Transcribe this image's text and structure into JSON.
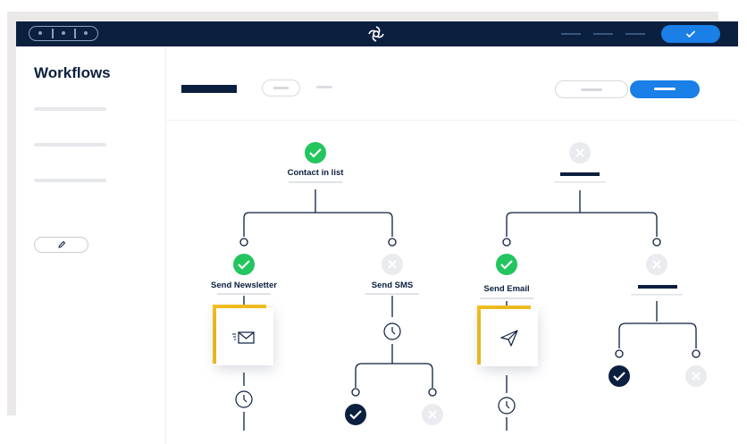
{
  "sidebar": {
    "title": "Workflows"
  },
  "nodes": {
    "contact_in_list": {
      "label": "Contact in list",
      "status": "done"
    },
    "send_newsletter": {
      "label": "Send Newsletter",
      "status": "done"
    },
    "send_sms": {
      "label": "Send SMS",
      "status": "skipped"
    },
    "send_email": {
      "label": "Send Email",
      "status": "done"
    }
  },
  "colors": {
    "navy": "#0b1f3f",
    "success": "#22c55e",
    "primary": "#1a7fe6",
    "accent": "#f7c11e",
    "muted": "#e6e8eb"
  },
  "icons": [
    "workflow-logo-icon",
    "check-icon",
    "edit-pencil-icon",
    "close-icon",
    "envelope-icon",
    "send-icon",
    "clock-icon"
  ]
}
